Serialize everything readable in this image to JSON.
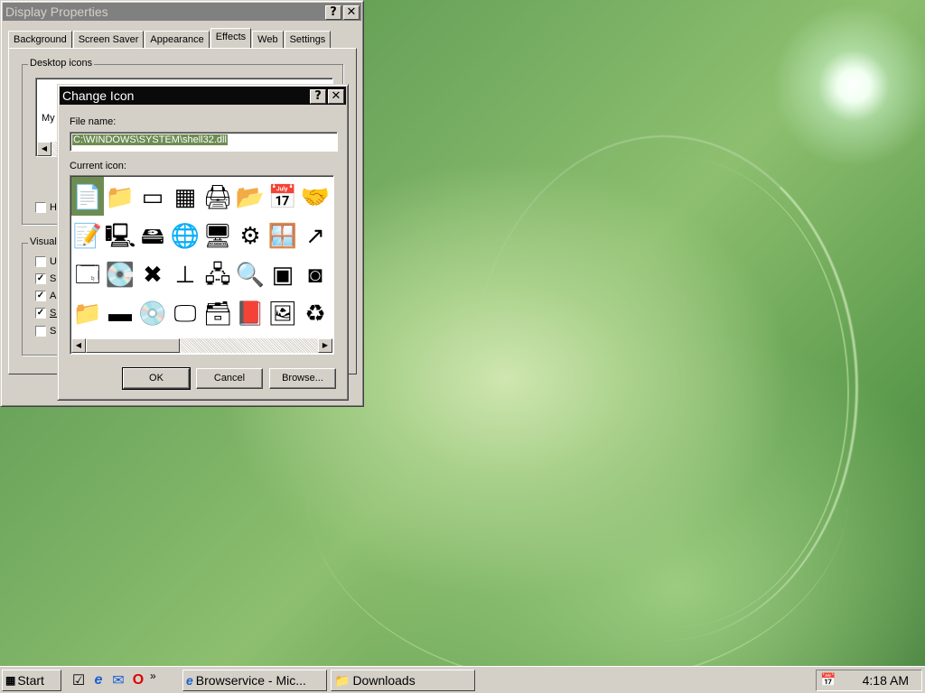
{
  "display_properties": {
    "title": "Display Properties",
    "help_btn": "?",
    "close_btn": "✕",
    "tabs": [
      "Background",
      "Screen Saver",
      "Appearance",
      "Effects",
      "Web",
      "Settings"
    ],
    "selected_tab": "Effects",
    "desktop_icons_label": "Desktop icons",
    "icon_partial_label": "My C",
    "checkbox_partial": "H",
    "visual_label": "Visual",
    "visual_items": [
      {
        "text": "U",
        "checked": false
      },
      {
        "text": "Sh",
        "checked": true
      },
      {
        "text": "Ar",
        "checked": true
      },
      {
        "text": "Su",
        "checked": true
      },
      {
        "text": "Sh",
        "checked": false
      }
    ]
  },
  "change_icon": {
    "title": "Change Icon",
    "help_btn": "?",
    "close_btn": "✕",
    "file_name_label": "File name:",
    "file_name_value": "C:\\WINDOWS\\SYSTEM\\shell32.dll",
    "current_icon_label": "Current icon:",
    "icons": [
      "document-icon",
      "folder-icon",
      "drive-icon",
      "chip-icon",
      "printer-icon",
      "open-folder-icon",
      "calendar-icon",
      "handshake-icon",
      "text-document-icon",
      "computer-network-icon",
      "network-drive-icon",
      "globe-icon",
      "network-computers-icon",
      "gears-icon",
      "window-icon",
      "shortcut-arrow-icon",
      "program-window-icon",
      "computer-drive-icon",
      "disconnected-drive-icon",
      "network-cable-icon",
      "network-tree-icon",
      "find-icon",
      "scanner-icon",
      "small-badge-icon",
      "folder-closed-icon",
      "floppy-drive-icon",
      "cd-drive-icon",
      "monitor-icon",
      "control-panel-icon",
      "book-icon",
      "display-icon",
      "recycle-bin-icon"
    ],
    "icon_glyphs": [
      "📄",
      "📁",
      "▭",
      "▦",
      "🖨",
      "📂",
      "📅",
      "🤝",
      "📝",
      "🖳",
      "🖴",
      "🌐",
      "🖥",
      "⚙",
      "🪟",
      "↗",
      "🗔",
      "💽",
      "✖",
      "⊥",
      "🖧",
      "🔍",
      "▣",
      "◙",
      "📁",
      "▬",
      "💿",
      "🖵",
      "🗃",
      "📕",
      "🖼",
      "♻"
    ],
    "selected_icon": 0,
    "ok": "OK",
    "cancel": "Cancel",
    "browse": "Browse..."
  },
  "taskbar": {
    "start": "Start",
    "quick_launch": [
      "show-desktop-icon",
      "ie-icon",
      "outlook-express-icon",
      "opera-icon"
    ],
    "chevron": "»",
    "tasks": [
      "Browservice - Mic...",
      "Downloads"
    ],
    "clock": "4:18 AM"
  }
}
